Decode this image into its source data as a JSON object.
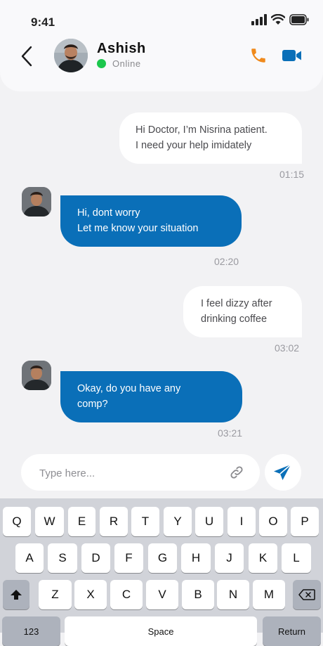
{
  "status_bar": {
    "time": "9:41",
    "icons": [
      "signal-icon",
      "wifi-icon",
      "battery-icon"
    ]
  },
  "header": {
    "contact_name": "Ashish",
    "status": "Online",
    "status_color": "#1cc74d",
    "actions": [
      "phone-icon",
      "video-camera-icon"
    ]
  },
  "colors": {
    "accent": "#0a6fb8",
    "call_icon": "#f08a1c",
    "video_icon": "#0a6fb8"
  },
  "messages": [
    {
      "direction": "outgoing",
      "lines": [
        "Hi Doctor, I’m Nisrina patient.",
        "I need your help imidately"
      ],
      "time": "01:15"
    },
    {
      "direction": "incoming",
      "lines": [
        "Hi, dont worry",
        "Let me know your situation"
      ],
      "time": "02:20"
    },
    {
      "direction": "outgoing",
      "lines": [
        "I feel dizzy after",
        "drinking coffee"
      ],
      "time": "03:02"
    },
    {
      "direction": "incoming",
      "lines": [
        "Okay, do you have any",
        "comp?"
      ],
      "time": "03:21"
    }
  ],
  "composer": {
    "placeholder": "Type here...",
    "value": ""
  },
  "keyboard": {
    "row1": [
      "Q",
      "W",
      "E",
      "R",
      "T",
      "Y",
      "U",
      "I",
      "O",
      "P"
    ],
    "row2": [
      "A",
      "S",
      "D",
      "F",
      "G",
      "H",
      "J",
      "K",
      "L"
    ],
    "row3": [
      "Z",
      "X",
      "C",
      "V",
      "B",
      "N",
      "M"
    ],
    "numbers_label": "123",
    "space_label": "Space",
    "return_label": "Return"
  }
}
